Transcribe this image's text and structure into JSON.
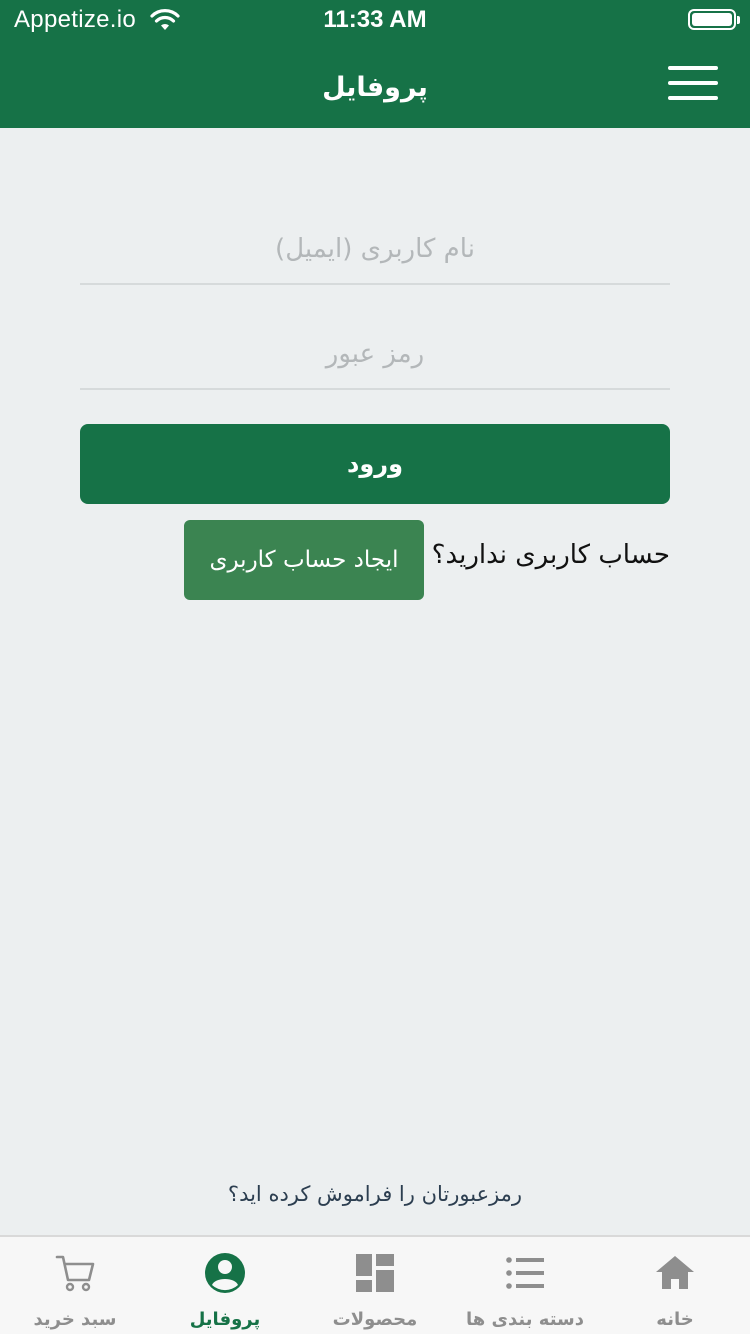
{
  "status_bar": {
    "carrier": "Appetize.io",
    "time": "11:33 AM"
  },
  "header": {
    "title": "پروفایل",
    "menu_icon": "hamburger-menu-icon"
  },
  "login_form": {
    "username_placeholder": "نام کاربری (ایمیل)",
    "password_placeholder": "رمز عبور",
    "login_label": "ورود",
    "no_account_text": "حساب کاربری ندارید؟",
    "create_account_label": "ایجاد حساب کاربری",
    "forgot_password_label": "رمزعبورتان را فراموش کرده اید؟"
  },
  "tabbar": {
    "tabs": [
      {
        "label": "سبد خرید",
        "icon": "cart-icon"
      },
      {
        "label": "پروفایل",
        "icon": "profile-icon",
        "active": true
      },
      {
        "label": "محصولات",
        "icon": "products-grid-icon"
      },
      {
        "label": "دسته بندی ها",
        "icon": "categories-list-icon"
      },
      {
        "label": "خانه",
        "icon": "home-icon"
      }
    ]
  },
  "colors": {
    "primary": "#167247",
    "secondary_button": "#3B8451",
    "background": "#ECEFF0",
    "inactive_tab": "#8E8E8E"
  }
}
